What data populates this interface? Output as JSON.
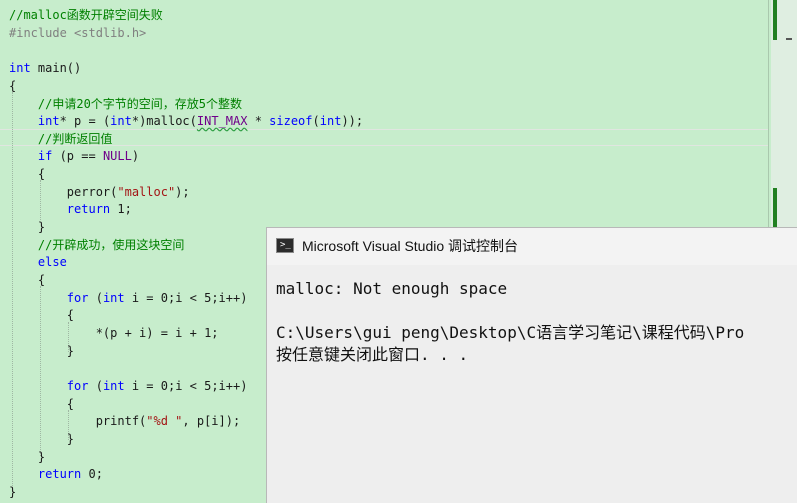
{
  "editor": {
    "lines": [
      {
        "text": "//malloc函数开辟空间失败"
      },
      {
        "text": "#include <stdlib.h>"
      },
      {
        "text": ""
      },
      {
        "text": "int main()"
      },
      {
        "text": "{"
      },
      {
        "text": "    //申请20个字节的空间，存放5个整数"
      },
      {
        "text": "    int* p = (int*)malloc(INT_MAX * sizeof(int));"
      },
      {
        "text": "    //判断返回值"
      },
      {
        "text": "    if (p == NULL)"
      },
      {
        "text": "    {"
      },
      {
        "text": "        perror(\"malloc\");"
      },
      {
        "text": "        return 1;"
      },
      {
        "text": "    }"
      },
      {
        "text": "    //开辟成功，使用这块空间"
      },
      {
        "text": "    else"
      },
      {
        "text": "    {"
      },
      {
        "text": "        for (int i = 0;i < 5;i++)"
      },
      {
        "text": "        {"
      },
      {
        "text": "            *(p + i) = i + 1;"
      },
      {
        "text": "        }"
      },
      {
        "text": ""
      },
      {
        "text": "        for (int i = 0;i < 5;i++)"
      },
      {
        "text": "        {"
      },
      {
        "text": "            printf(\"%d \", p[i]);"
      },
      {
        "text": "        }"
      },
      {
        "text": "    }"
      },
      {
        "text": "    return 0;"
      },
      {
        "text": "}"
      }
    ],
    "colors": {
      "background": "#c7edcc",
      "keyword": "#0000ff",
      "comment": "#008000",
      "preprocessor": "#808080",
      "string": "#a31515",
      "macro": "#6f008a"
    }
  },
  "console": {
    "title": "Microsoft Visual Studio 调试控制台",
    "icon": "console-window-icon",
    "output": [
      "malloc: Not enough space",
      "",
      "C:\\Users\\gui peng\\Desktop\\C语言学习笔记\\课程代码\\Pro",
      "按任意键关闭此窗口. . ."
    ]
  }
}
